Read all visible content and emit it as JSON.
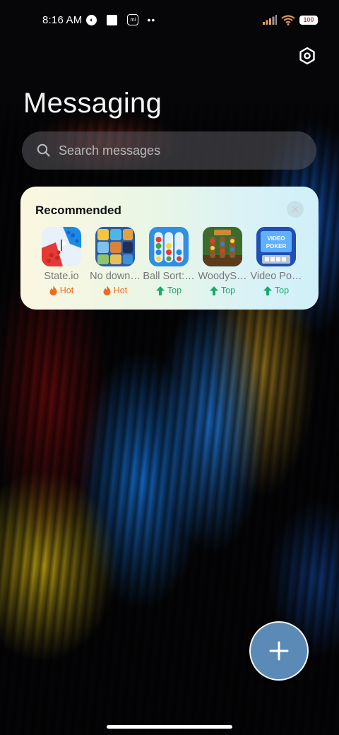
{
  "status_bar": {
    "time": "8:16 AM",
    "icons": [
      "app-notification-icon",
      "square-notification-icon",
      "mi-icon",
      "more-dots-icon",
      "signal-icon",
      "wifi-icon",
      "battery-icon"
    ],
    "dots": "••",
    "mi_label": "mi",
    "battery_level": "100"
  },
  "header": {
    "title": "Messaging",
    "settings_icon": "settings-hexagon-icon"
  },
  "search": {
    "placeholder": "Search messages",
    "icon": "search-icon"
  },
  "recommended": {
    "title": "Recommended",
    "close_icon": "close-icon",
    "apps": [
      {
        "name": "State.io",
        "badge": "Hot",
        "badge_type": "hot"
      },
      {
        "name": "No down…",
        "badge": "Hot",
        "badge_type": "hot"
      },
      {
        "name": "Ball Sort:…",
        "badge": "Top",
        "badge_type": "top"
      },
      {
        "name": "WoodyS…",
        "badge": "Top",
        "badge_type": "top"
      },
      {
        "name": "Video Po…",
        "badge": "Top",
        "badge_type": "top"
      }
    ],
    "video_poker_icon_text": "VIDEO POKER"
  },
  "fab": {
    "icon": "plus-icon"
  },
  "colors": {
    "fab": "#5b8ab7",
    "hot": "#f06b1f",
    "top": "#19a96b"
  }
}
